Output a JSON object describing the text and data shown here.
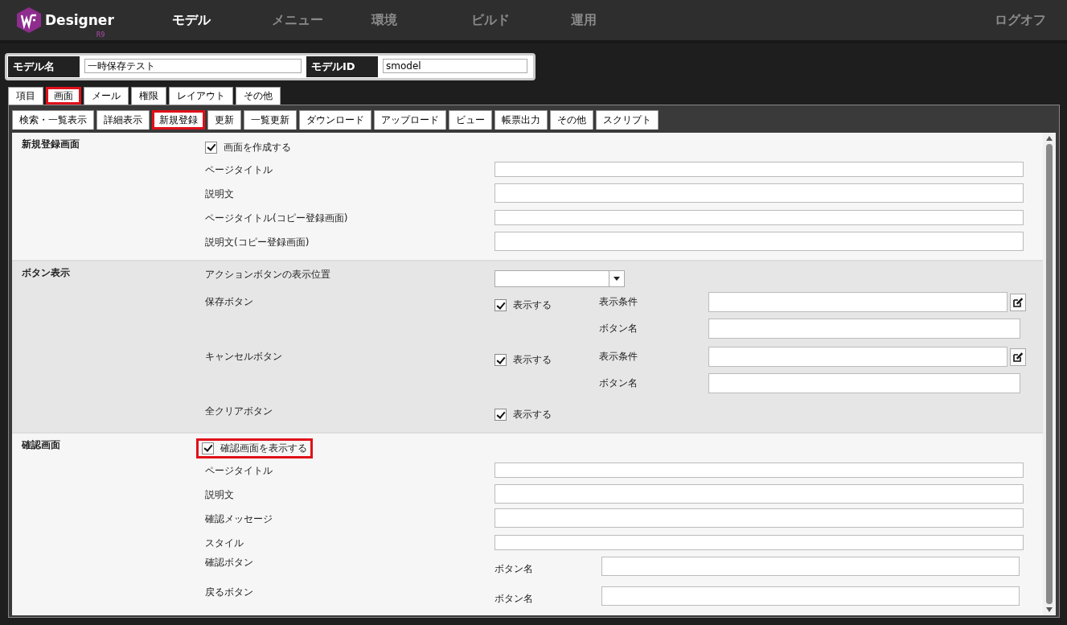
{
  "app": {
    "logo_text": "Designer",
    "logo_version": "R9",
    "nav": [
      {
        "label": "モデル",
        "selected": true
      },
      {
        "label": "メニュー",
        "selected": false
      },
      {
        "label": "環境",
        "selected": false
      },
      {
        "label": "ビルド",
        "selected": false
      },
      {
        "label": "運用",
        "selected": false
      }
    ],
    "logoff": "ログオフ"
  },
  "model": {
    "name_label": "モデル名",
    "name_value": "一時保存テスト",
    "id_label": "モデルID",
    "id_value": "smodel"
  },
  "tabs": [
    {
      "label": "項目",
      "selected": false
    },
    {
      "label": "画面",
      "selected": true
    },
    {
      "label": "メール",
      "selected": false
    },
    {
      "label": "権限",
      "selected": false
    },
    {
      "label": "レイアウト",
      "selected": false
    },
    {
      "label": "その他",
      "selected": false
    }
  ],
  "subtabs": [
    {
      "label": "検索・一覧表示",
      "selected": false
    },
    {
      "label": "詳細表示",
      "selected": false
    },
    {
      "label": "新規登録",
      "selected": true
    },
    {
      "label": "更新",
      "selected": false
    },
    {
      "label": "一覧更新",
      "selected": false
    },
    {
      "label": "ダウンロード",
      "selected": false
    },
    {
      "label": "アップロード",
      "selected": false
    },
    {
      "label": "ビュー",
      "selected": false
    },
    {
      "label": "帳票出力",
      "selected": false
    },
    {
      "label": "その他",
      "selected": false
    },
    {
      "label": "スクリプト",
      "selected": false
    }
  ],
  "sections": [
    {
      "title": "新規登録画面",
      "shaded": false,
      "rows": [
        {
          "kind": "checkbox",
          "label": "画面を作成する",
          "checked": true,
          "highlighted": false
        },
        {
          "kind": "text",
          "label": "ページタイトル",
          "short": true
        },
        {
          "kind": "text",
          "label": "説明文",
          "short": false
        },
        {
          "kind": "text",
          "label": "ページタイトル(コピー登録画面)",
          "short": true
        },
        {
          "kind": "text",
          "label": "説明文(コピー登録画面)",
          "short": false
        }
      ]
    },
    {
      "title": "ボタン表示",
      "shaded": true,
      "rows": [
        {
          "kind": "select",
          "label": "アクションボタンの表示位置"
        },
        {
          "kind": "button",
          "label": "保存ボタン",
          "option": "表示する",
          "checked": true,
          "condition_label": "表示条件",
          "name_label": "ボタン名"
        },
        {
          "kind": "button",
          "label": "キャンセルボタン",
          "option": "表示する",
          "checked": true,
          "condition_label": "表示条件",
          "name_label": "ボタン名"
        },
        {
          "kind": "option",
          "label": "全クリアボタン",
          "option": "表示する",
          "checked": true
        }
      ]
    },
    {
      "title": "確認画面",
      "shaded": false,
      "rows": [
        {
          "kind": "checkbox",
          "label": "確認画面を表示する",
          "checked": true,
          "highlighted": true
        },
        {
          "kind": "text",
          "label": "ページタイトル",
          "short": true
        },
        {
          "kind": "text",
          "label": "説明文",
          "short": false
        },
        {
          "kind": "text",
          "label": "確認メッセージ",
          "short": false
        },
        {
          "kind": "text",
          "label": "スタイル",
          "short": true
        },
        {
          "kind": "named",
          "label": "確認ボタン",
          "name_label": "ボタン名"
        },
        {
          "kind": "named",
          "label": "戻るボタン",
          "name_label": "ボタン名"
        }
      ]
    }
  ]
}
